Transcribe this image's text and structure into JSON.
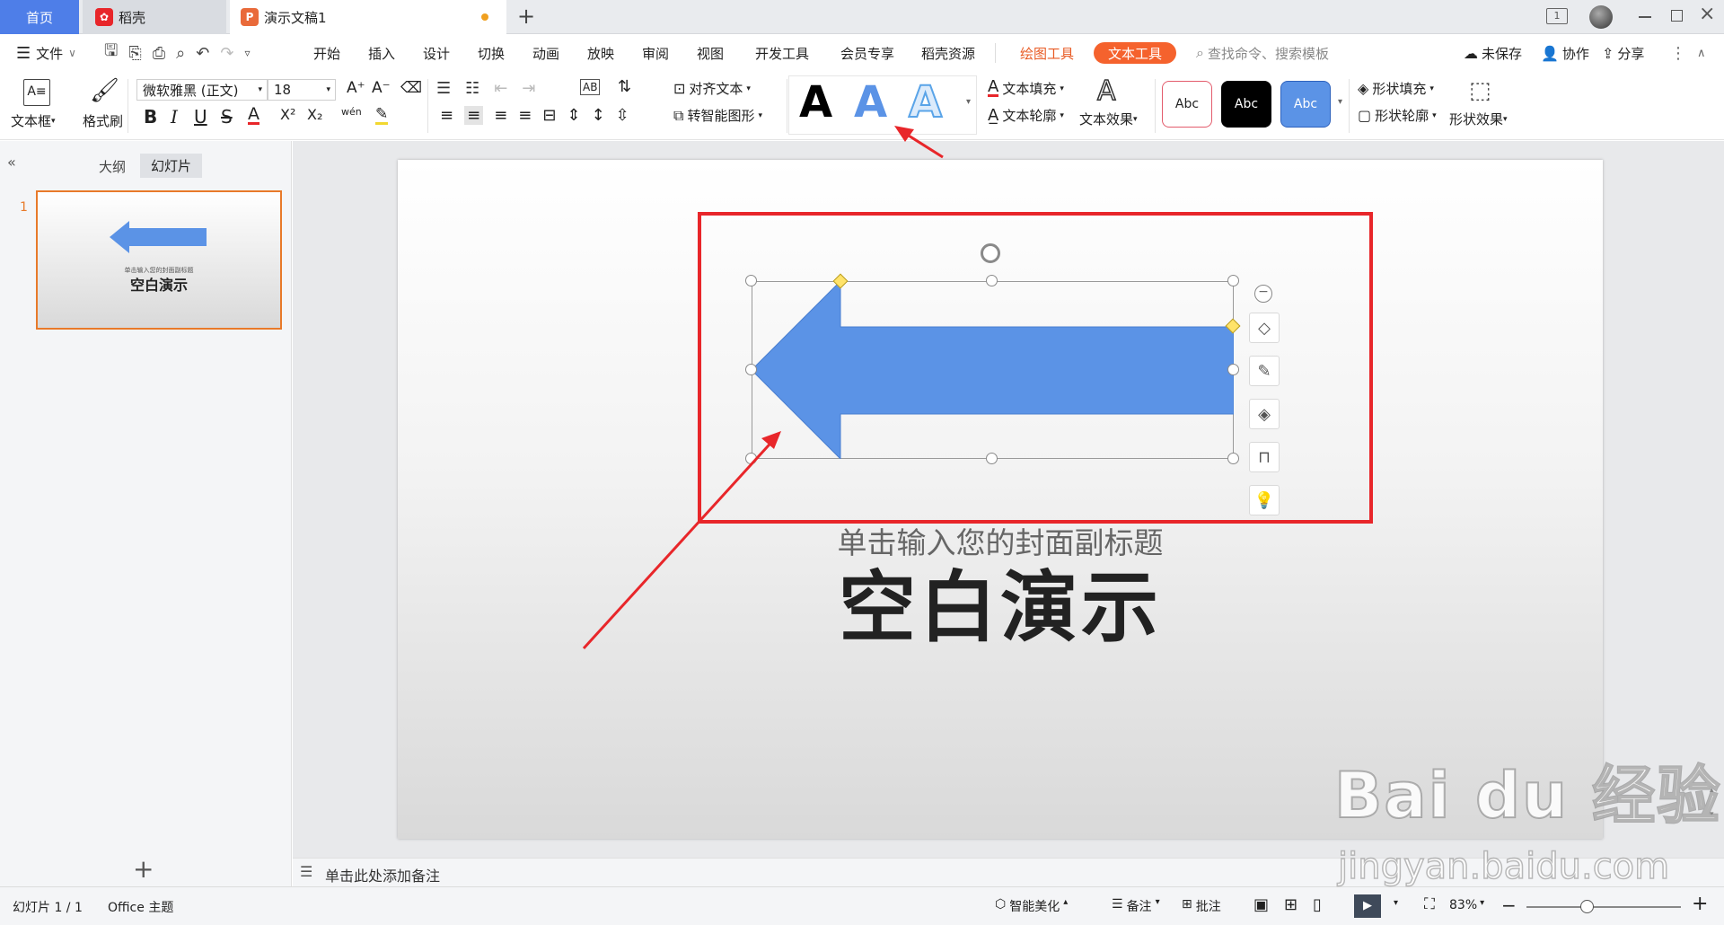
{
  "tabs": {
    "home": "首页",
    "daoke": "稻壳",
    "doc": "演示文稿1",
    "new_tab": "+"
  },
  "menu": {
    "file": "文件",
    "items": [
      "开始",
      "插入",
      "设计",
      "切换",
      "动画",
      "放映",
      "审阅",
      "视图",
      "开发工具",
      "会员专享",
      "稻壳资源"
    ],
    "drawing_tools": "绘图工具",
    "text_tools": "文本工具",
    "search_placeholder": "查找命令、搜索模板",
    "unsaved": "未保存",
    "collab": "协作",
    "share": "分享"
  },
  "ribbon": {
    "textbox": "文本框",
    "format_painter": "格式刷",
    "font_name": "微软雅黑 (正文)",
    "font_size": "18",
    "align_text": "对齐文本",
    "to_smartart": "转智能图形",
    "text_fill": "文本填充",
    "text_outline": "文本轮廓",
    "text_effect": "文本效果",
    "shape_fill": "形状填充",
    "shape_outline": "形状轮廓",
    "shape_effect": "形状效果",
    "style_letter": "A",
    "shape_style_label": "Abc",
    "bold": "B",
    "italic": "I",
    "underline": "U",
    "strike": "S",
    "superscript": "X²",
    "subscript": "X₂",
    "font_grow": "A⁺",
    "font_shrink": "A⁻",
    "pinyin": "wén"
  },
  "leftpanel": {
    "outline_tab": "大纲",
    "slides_tab": "幻灯片",
    "slide_number": "1",
    "thumb_subtitle": "单击输入您的封面副标题",
    "thumb_title": "空白演示",
    "add": "+"
  },
  "slide": {
    "subtitle": "单击输入您的封面副标题",
    "title": "空白演示",
    "arrow_color": "#5b93e6"
  },
  "notes_placeholder": "单击此处添加备注",
  "status": {
    "slide_count": "幻灯片 1 / 1",
    "theme": "Office 主题",
    "beautify": "智能美化",
    "notes": "备注",
    "comments": "批注",
    "zoom": "83%"
  },
  "watermark": {
    "brand": "Bai du 经验",
    "url": "jingyan.baidu.com"
  },
  "colors": {
    "accent_blue": "#4e7ee8",
    "highlight_red": "#e8262a",
    "drawing_tools_text": "#e85a23",
    "text_tools_bg": "#f5622d"
  }
}
